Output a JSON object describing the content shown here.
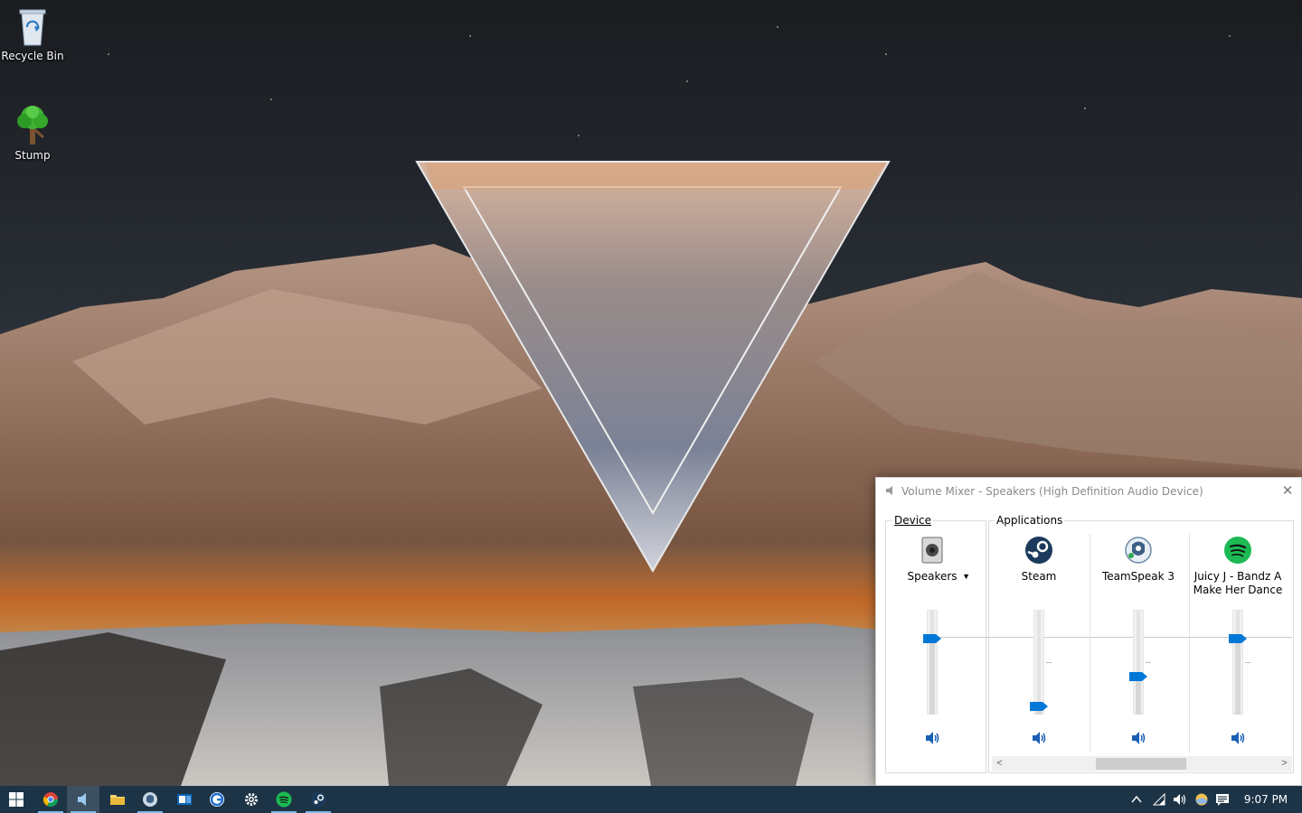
{
  "desktop": {
    "icons": [
      {
        "label": "Recycle Bin",
        "icon": "recycle-bin-icon"
      },
      {
        "label": "Stump",
        "icon": "tree-icon"
      }
    ]
  },
  "volume_mixer": {
    "title": "Volume Mixer - Speakers (High Definition Audio Device)",
    "device_group_label": "Device",
    "applications_group_label": "Applications",
    "device": {
      "name": "Speakers",
      "icon": "speaker-device-icon",
      "volume": 0.72
    },
    "applications": [
      {
        "name": "Steam",
        "icon": "steam-icon",
        "volume": 0.08
      },
      {
        "name": "TeamSpeak 3",
        "icon": "teamspeak-icon",
        "volume": 0.36
      },
      {
        "name": "Juicy J - Bandz A Make Her Dance",
        "icon": "spotify-icon",
        "volume": 0.72
      }
    ],
    "colors": {
      "accent": "#0078d7",
      "spotify": "#1db954",
      "steam": "#1b3a5c"
    }
  },
  "taskbar": {
    "buttons": [
      {
        "name": "start-button",
        "icon": "windows-logo-icon"
      },
      {
        "name": "chrome",
        "icon": "chrome-icon"
      },
      {
        "name": "volume-mixer-app",
        "icon": "speaker-icon"
      },
      {
        "name": "file-explorer",
        "icon": "folder-icon"
      },
      {
        "name": "teamspeak",
        "icon": "teamspeak-icon"
      },
      {
        "name": "outlook",
        "icon": "mail-icon"
      },
      {
        "name": "grammarly",
        "icon": "g-circle-icon"
      },
      {
        "name": "settings",
        "icon": "gear-icon"
      },
      {
        "name": "spotify",
        "icon": "spotify-icon"
      },
      {
        "name": "steam",
        "icon": "steam-icon"
      }
    ],
    "tray": [
      "chevron-up-icon",
      "network-icon",
      "volume-icon",
      "weather-icon",
      "notification-icon"
    ],
    "clock": "9:07 PM",
    "color": "#1d3447"
  }
}
